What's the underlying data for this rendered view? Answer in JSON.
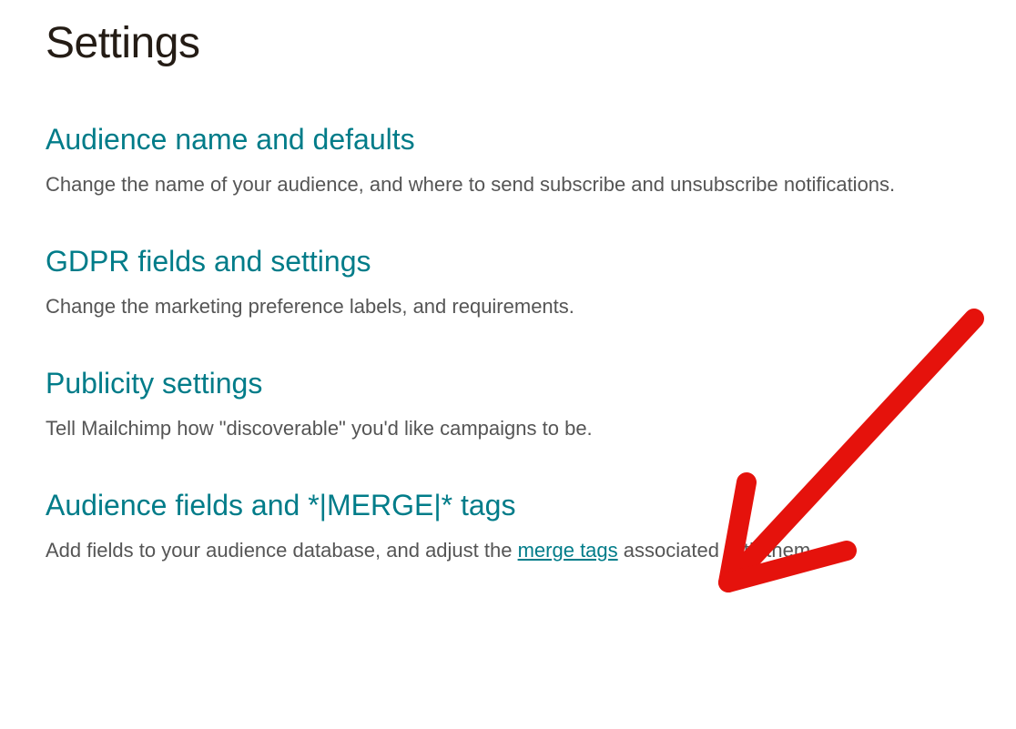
{
  "page_title": "Settings",
  "sections": [
    {
      "link": "Audience name and defaults",
      "description": "Change the name of your audience, and where to send subscribe and unsubscribe notifications."
    },
    {
      "link": "GDPR fields and settings",
      "description": "Change the marketing preference labels, and requirements."
    },
    {
      "link": "Publicity settings",
      "description": "Tell Mailchimp how \"discoverable\" you'd like campaigns to be."
    },
    {
      "link": "Audience fields and *|MERGE|* tags",
      "description_prefix": "Add fields to your audience database, and adjust the ",
      "inline_link": "merge tags",
      "description_suffix": " associated with them."
    }
  ],
  "colors": {
    "accent": "#007c89",
    "text_primary": "#241c15",
    "text_secondary": "#555555",
    "annotation": "#e5120c"
  }
}
